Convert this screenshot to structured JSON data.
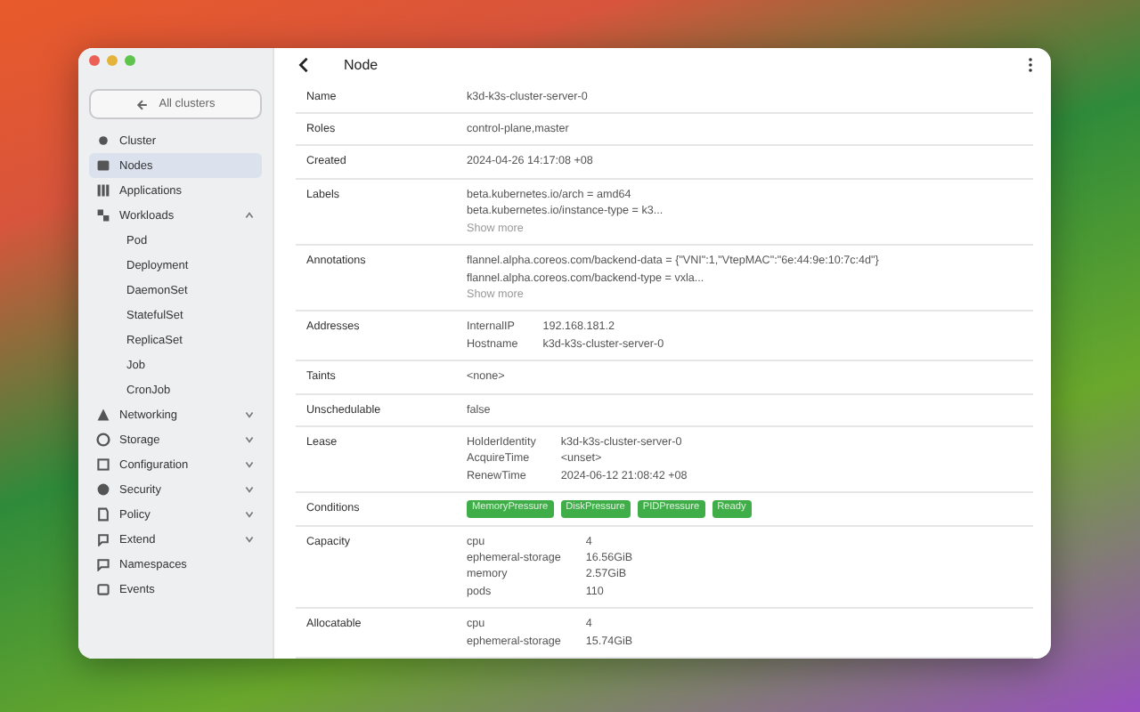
{
  "sidebar": {
    "back_button": "All clusters",
    "items": [
      {
        "label": "Cluster",
        "selected": false
      },
      {
        "label": "Nodes",
        "selected": true
      },
      {
        "label": "Applications",
        "selected": false
      },
      {
        "label": "Workloads",
        "selected": false,
        "expanded": true,
        "children": [
          {
            "label": "Pod",
            "selected": false
          },
          {
            "label": "Deployment",
            "selected": false
          },
          {
            "label": "DaemonSet",
            "selected": false
          },
          {
            "label": "StatefulSet",
            "selected": false
          },
          {
            "label": "ReplicaSet",
            "selected": false
          },
          {
            "label": "Job",
            "selected": false
          },
          {
            "label": "CronJob",
            "selected": false
          }
        ]
      },
      {
        "label": "Networking",
        "selected": false,
        "expanded": false
      },
      {
        "label": "Storage",
        "selected": false,
        "expanded": false
      },
      {
        "label": "Configuration",
        "selected": false,
        "expanded": false
      },
      {
        "label": "Security",
        "selected": false,
        "expanded": false
      },
      {
        "label": "Policy",
        "selected": false,
        "expanded": false
      },
      {
        "label": "Extend",
        "selected": false,
        "expanded": false
      },
      {
        "label": "Namespaces",
        "selected": false
      },
      {
        "label": "Events",
        "selected": false
      }
    ]
  },
  "header": {
    "title": "Node"
  },
  "rows": [
    {
      "kind": "text",
      "label": "Name",
      "value": "k3d-k3s-cluster-server-0"
    },
    {
      "kind": "text",
      "label": "Roles",
      "value": "control-plane,master"
    },
    {
      "kind": "text",
      "label": "Created",
      "value": "2024-04-26 14:17:08 +08"
    },
    {
      "kind": "lines",
      "label": "Labels",
      "lines": [
        "beta.kubernetes.io/arch = amd64",
        "beta.kubernetes.io/instance-type = k3..."
      ],
      "more": "Show more"
    },
    {
      "kind": "lines",
      "label": "Annotations",
      "lines": [
        "flannel.alpha.coreos.com/backend-data = {\"VNI\":1,\"VtepMAC\":\"6e:44:9e:10:7c:4d\"}",
        "flannel.alpha.coreos.com/backend-type = vxla..."
      ],
      "more": "Show more"
    },
    {
      "kind": "pairs",
      "label": "Addresses",
      "pairs": [
        [
          "InternalIP",
          "192.168.181.2"
        ],
        [
          "Hostname",
          "k3d-k3s-cluster-server-0"
        ]
      ]
    },
    {
      "kind": "text",
      "label": "Taints",
      "value": "<none>"
    },
    {
      "kind": "text",
      "label": "Unschedulable",
      "value": "false"
    },
    {
      "kind": "pairs",
      "label": "Lease",
      "pairs": [
        [
          "HolderIdentity",
          "k3d-k3s-cluster-server-0"
        ],
        [
          "AcquireTime",
          "<unset>"
        ],
        [
          "RenewTime",
          "2024-06-12 21:08:42 +08"
        ]
      ]
    },
    {
      "kind": "badges",
      "label": "Conditions",
      "badges": [
        "MemoryPressure",
        "DiskPressure",
        "PIDPressure",
        "Ready"
      ]
    },
    {
      "kind": "pairs",
      "label": "Capacity",
      "pairs": [
        [
          "cpu",
          "4"
        ],
        [
          "ephemeral-storage",
          "16.56GiB"
        ],
        [
          "memory",
          "2.57GiB"
        ],
        [
          "pods",
          "110"
        ]
      ]
    },
    {
      "kind": "pairs",
      "label": "Allocatable",
      "pairs": [
        [
          "cpu",
          "4"
        ],
        [
          "ephemeral-storage",
          "15.74GiB"
        ]
      ]
    }
  ]
}
